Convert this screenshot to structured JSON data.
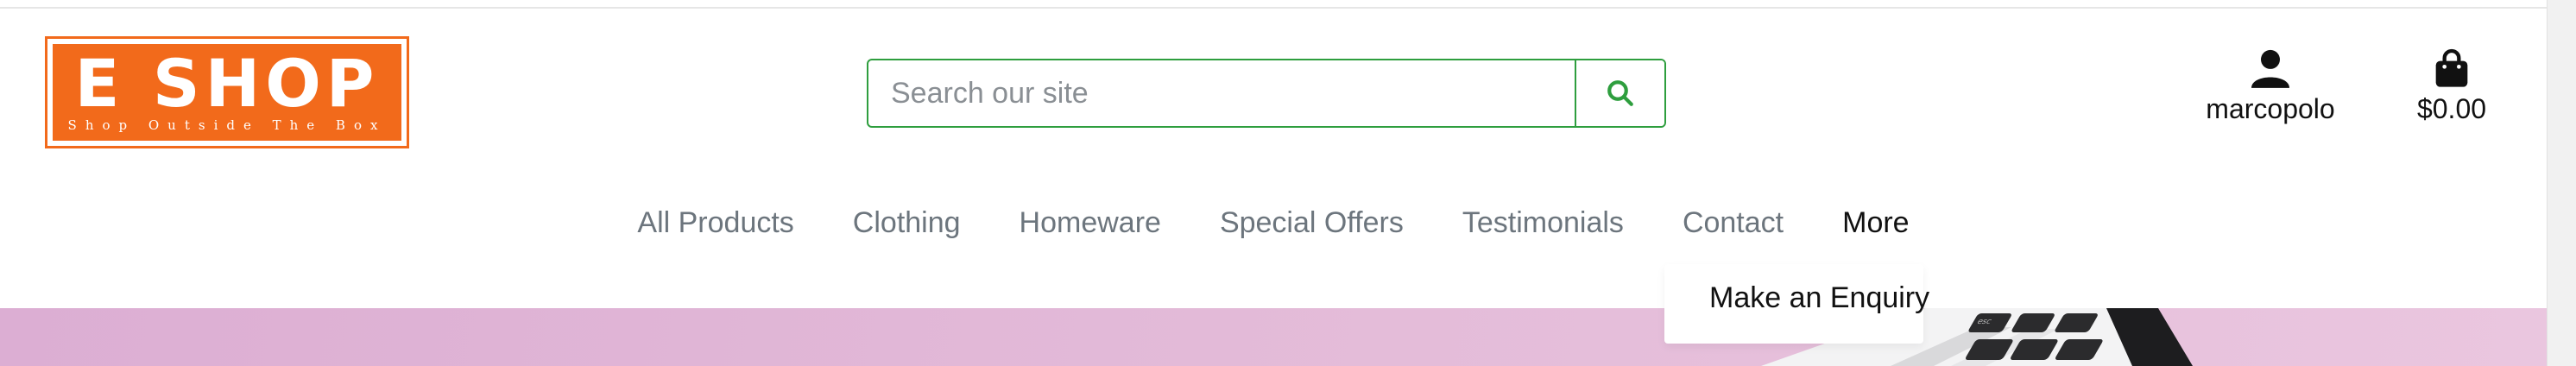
{
  "brand": {
    "logo_title": "E SHOP",
    "logo_tagline": "Shop Outside The Box",
    "accent_color": "#f26a1b"
  },
  "search": {
    "placeholder": "Search our site",
    "value": "",
    "button_icon": "search-icon",
    "accent_color": "#2e9e3e"
  },
  "account": {
    "icon": "user-icon",
    "label": "marcopolo"
  },
  "bag": {
    "icon": "shopping-bag-icon",
    "total": "$0.00"
  },
  "nav": {
    "items": [
      {
        "label": "All Products"
      },
      {
        "label": "Clothing"
      },
      {
        "label": "Homeware"
      },
      {
        "label": "Special Offers"
      },
      {
        "label": "Testimonials"
      },
      {
        "label": "Contact"
      },
      {
        "label": "More"
      }
    ],
    "text_color": "#6c757d",
    "active_color": "#111111"
  },
  "more_menu": {
    "items": [
      {
        "label": "Make an Enquiry"
      }
    ]
  },
  "hero": {
    "background_color": "#e4bcd9"
  }
}
